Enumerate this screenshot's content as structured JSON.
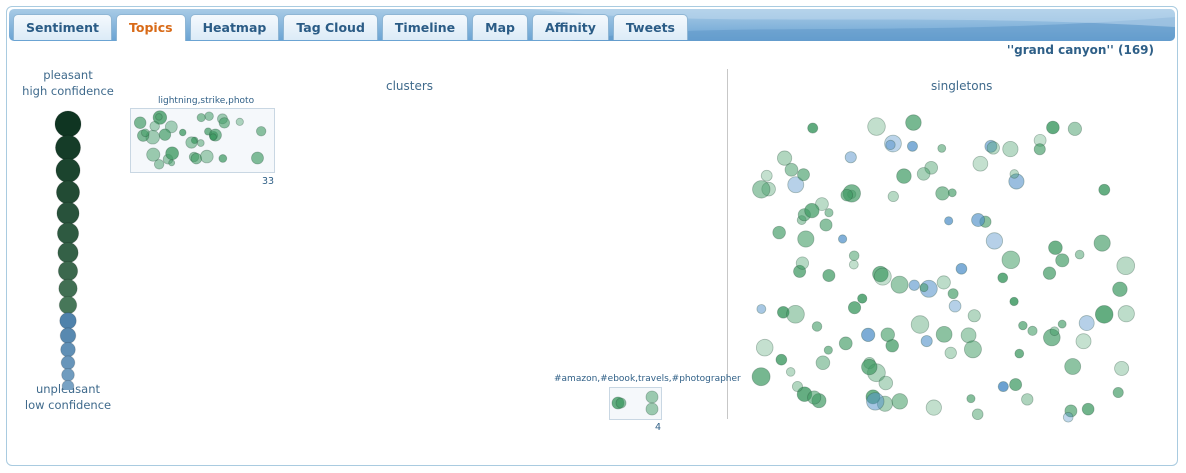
{
  "tabs": [
    {
      "label": "Sentiment",
      "active": false
    },
    {
      "label": "Topics",
      "active": true
    },
    {
      "label": "Heatmap",
      "active": false
    },
    {
      "label": "Tag Cloud",
      "active": false
    },
    {
      "label": "Timeline",
      "active": false
    },
    {
      "label": "Map",
      "active": false
    },
    {
      "label": "Affinity",
      "active": false
    },
    {
      "label": "Tweets",
      "active": false
    }
  ],
  "query": {
    "text": "''grand canyon'' (169)"
  },
  "legend": {
    "top_line1": "pleasant",
    "top_line2": "high confidence",
    "bottom_line1": "unpleasant",
    "bottom_line2": "low confidence"
  },
  "sections": {
    "clusters": "clusters",
    "singletons": "singletons"
  },
  "clusters": [
    {
      "label": "lightning,strike,photo",
      "count": "33"
    },
    {
      "label": "#amazon,#ebook,travels,#photographer",
      "count": "4"
    }
  ],
  "colors": {
    "pleasant": "#0f3522",
    "unpleasant": "#a9c8e2",
    "green": "#3f9a63",
    "blue": "#4f8fc8",
    "accent": "#d86a17"
  }
}
